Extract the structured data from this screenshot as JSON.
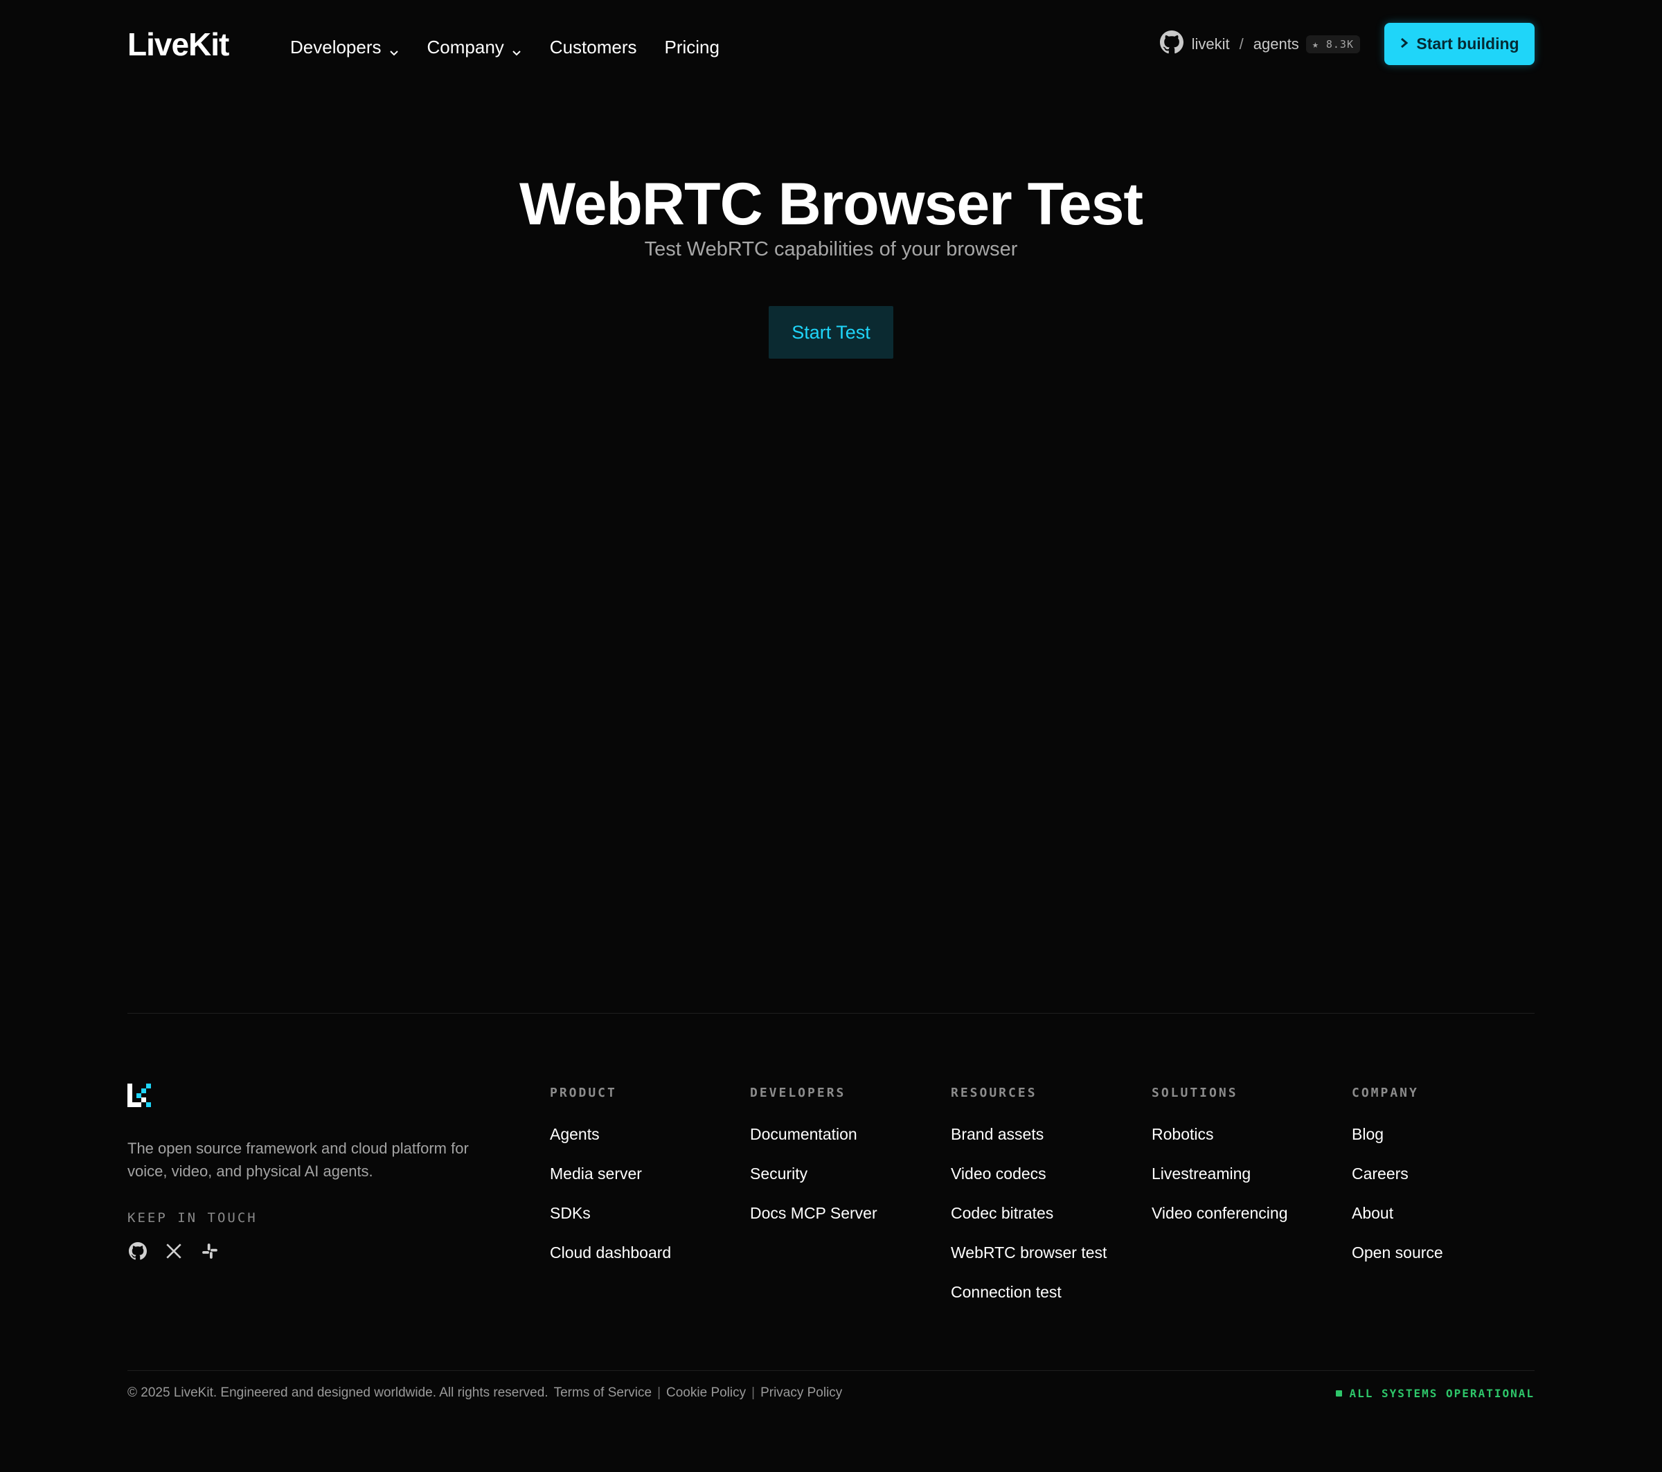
{
  "header": {
    "logo_text": "LiveKit",
    "nav": [
      {
        "label": "Developers",
        "has_dropdown": true
      },
      {
        "label": "Company",
        "has_dropdown": true
      },
      {
        "label": "Customers",
        "has_dropdown": false
      },
      {
        "label": "Pricing",
        "has_dropdown": false
      }
    ],
    "github": {
      "owner": "livekit",
      "separator": "/",
      "repo": "agents",
      "stars": "★ 8.3K"
    },
    "cta_label": "Start building"
  },
  "hero": {
    "title": "WebRTC Browser Test",
    "subtitle": "Test WebRTC capabilities of your browser",
    "button_label": "Start Test"
  },
  "footer": {
    "description": "The open source framework and cloud platform for voice, video, and physical AI agents.",
    "keep_in_touch": "KEEP IN TOUCH",
    "social": [
      "github-icon",
      "x-icon",
      "slack-icon"
    ],
    "columns": [
      {
        "heading": "PRODUCT",
        "links": [
          "Agents",
          "Media server",
          "SDKs",
          "Cloud dashboard"
        ]
      },
      {
        "heading": "DEVELOPERS",
        "links": [
          "Documentation",
          "Security",
          "Docs MCP Server"
        ]
      },
      {
        "heading": "RESOURCES",
        "links": [
          "Brand assets",
          "Video codecs",
          "Codec bitrates",
          "WebRTC browser test",
          "Connection test"
        ]
      },
      {
        "heading": "SOLUTIONS",
        "links": [
          "Robotics",
          "Livestreaming",
          "Video conferencing"
        ]
      },
      {
        "heading": "COMPANY",
        "links": [
          "Blog",
          "Careers",
          "About",
          "Open source"
        ]
      }
    ],
    "copyright": "© 2025 LiveKit. Engineered and designed worldwide. All rights reserved.",
    "legal": [
      "Terms of Service",
      "Cookie Policy",
      "Privacy Policy"
    ],
    "legal_separator": "|",
    "status": "ALL SYSTEMS OPERATIONAL"
  },
  "colors": {
    "accent": "#1fd5f9",
    "status_ok": "#2ec66a",
    "background": "#070707"
  }
}
